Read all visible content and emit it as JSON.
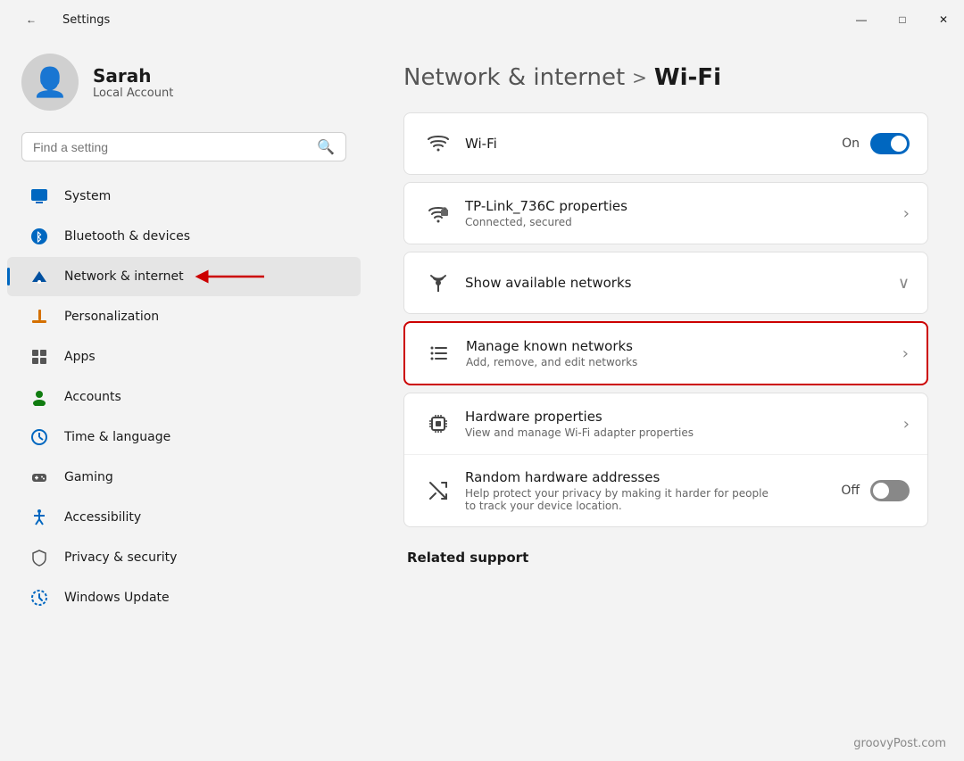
{
  "titlebar": {
    "title": "Settings",
    "back_label": "←",
    "minimize": "—",
    "maximize": "□",
    "close": "✕"
  },
  "user": {
    "name": "Sarah",
    "account_type": "Local Account"
  },
  "search": {
    "placeholder": "Find a setting"
  },
  "nav": {
    "items": [
      {
        "id": "system",
        "label": "System",
        "icon": "🖥",
        "active": false
      },
      {
        "id": "bluetooth",
        "label": "Bluetooth & devices",
        "icon": "🔷",
        "active": false
      },
      {
        "id": "network",
        "label": "Network & internet",
        "icon": "💎",
        "active": true
      },
      {
        "id": "personalization",
        "label": "Personalization",
        "icon": "✏️",
        "active": false
      },
      {
        "id": "apps",
        "label": "Apps",
        "icon": "📦",
        "active": false
      },
      {
        "id": "accounts",
        "label": "Accounts",
        "icon": "🟢",
        "active": false
      },
      {
        "id": "time",
        "label": "Time & language",
        "icon": "🕐",
        "active": false
      },
      {
        "id": "gaming",
        "label": "Gaming",
        "icon": "🎮",
        "active": false
      },
      {
        "id": "accessibility",
        "label": "Accessibility",
        "icon": "♿",
        "active": false
      },
      {
        "id": "privacy",
        "label": "Privacy & security",
        "icon": "🛡",
        "active": false
      },
      {
        "id": "windows-update",
        "label": "Windows Update",
        "icon": "🔄",
        "active": false
      }
    ]
  },
  "breadcrumb": {
    "parent": "Network & internet",
    "separator": ">",
    "current": "Wi-Fi"
  },
  "wifi_section": {
    "rows": [
      {
        "id": "wifi-toggle",
        "title": "Wi-Fi",
        "subtitle": "",
        "value": "On",
        "control": "toggle-on",
        "icon": "wifi"
      },
      {
        "id": "tp-link",
        "title": "TP-Link_736C properties",
        "subtitle": "Connected, secured",
        "value": "",
        "control": "chevron",
        "icon": "wifi-lock"
      },
      {
        "id": "show-networks",
        "title": "Show available networks",
        "subtitle": "",
        "value": "",
        "control": "chevron-down",
        "icon": "network-antenna"
      }
    ]
  },
  "manage_card": {
    "id": "manage-networks",
    "title": "Manage known networks",
    "subtitle": "Add, remove, and edit networks",
    "control": "chevron",
    "icon": "list-lines",
    "highlighted": true
  },
  "hardware_section": {
    "rows": [
      {
        "id": "hardware-properties",
        "title": "Hardware properties",
        "subtitle": "View and manage Wi-Fi adapter properties",
        "control": "chevron",
        "icon": "chip"
      },
      {
        "id": "random-addresses",
        "title": "Random hardware addresses",
        "subtitle": "Help protect your privacy by making it harder for people to track your device location.",
        "value": "Off",
        "control": "toggle-off",
        "icon": "shuffle"
      }
    ]
  },
  "related_support": {
    "title": "Related support"
  },
  "watermark": {
    "text": "groovyPost.com"
  }
}
